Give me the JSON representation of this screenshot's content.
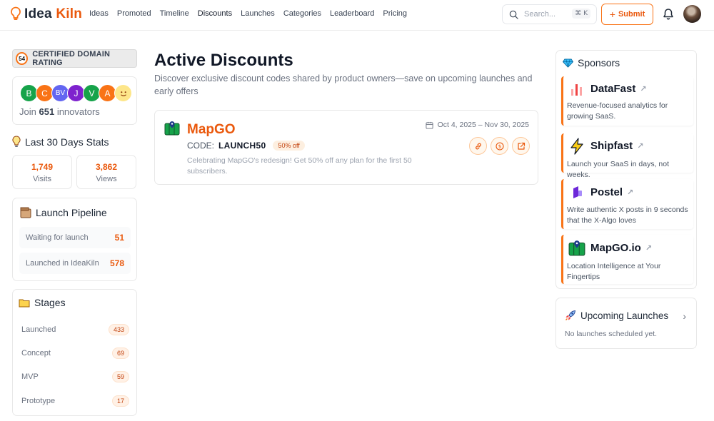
{
  "header": {
    "logo_word1": "Idea",
    "logo_word2": "Kiln",
    "nav": [
      "Ideas",
      "Promoted",
      "Timeline",
      "Discounts",
      "Launches",
      "Categories",
      "Leaderboard",
      "Pricing"
    ],
    "search_placeholder": "Search...",
    "search_shortcut": "⌘ K",
    "submit_label": "Submit",
    "accent": "#ea580c"
  },
  "left": {
    "cert_score": "54",
    "cert_label": "CERTIFIED DOMAIN RATING",
    "avatars": [
      {
        "letter": "B",
        "color": "#16a34a"
      },
      {
        "letter": "C",
        "color": "#f97316"
      },
      {
        "letter": "BV",
        "color": "#6366f1"
      },
      {
        "letter": "J",
        "color": "#7e22ce"
      },
      {
        "letter": "V",
        "color": "#16a34a"
      },
      {
        "letter": "A",
        "color": "#f97316"
      }
    ],
    "join_prefix": "Join",
    "join_count": "651",
    "join_suffix": "innovators",
    "stats_title": "Last 30 Days Stats",
    "visits_value": "1,749",
    "visits_label": "Visits",
    "views_value": "3,862",
    "views_label": "Views",
    "pipeline_title": "Launch Pipeline",
    "pipeline": [
      {
        "label": "Waiting for launch",
        "value": "51"
      },
      {
        "label": "Launched in IdeaKiln",
        "value": "578"
      }
    ],
    "stages_title": "Stages",
    "stages": [
      {
        "label": "Launched",
        "count": "433"
      },
      {
        "label": "Concept",
        "count": "69"
      },
      {
        "label": "MVP",
        "count": "59"
      },
      {
        "label": "Prototype",
        "count": "17"
      }
    ]
  },
  "main": {
    "title": "Active Discounts",
    "subtitle": "Discover exclusive discount codes shared by product owners—save on upcoming launches and early offers",
    "discount": {
      "name": "MapGO",
      "code_label": "CODE:",
      "code": "LAUNCH50",
      "badge": "50% off",
      "description": "Celebrating MapGO's redesign! Get 50% off any plan for the first 50 subscribers.",
      "dates": "Oct 4, 2025 – Nov 30, 2025"
    }
  },
  "right": {
    "sponsors_title": "Sponsors",
    "sponsors": [
      {
        "name": "DataFast",
        "desc": "Revenue-focused analytics for growing SaaS."
      },
      {
        "name": "Shipfast",
        "desc": "Launch your SaaS in days, not weeks."
      },
      {
        "name": "Postel",
        "desc": "Write authentic X posts in 9 seconds that the X-Algo loves"
      },
      {
        "name": "MapGO.io",
        "desc": "Location Intelligence at Your Fingertips"
      }
    ],
    "upcoming_title": "Upcoming Launches",
    "upcoming_empty": "No launches scheduled yet."
  }
}
